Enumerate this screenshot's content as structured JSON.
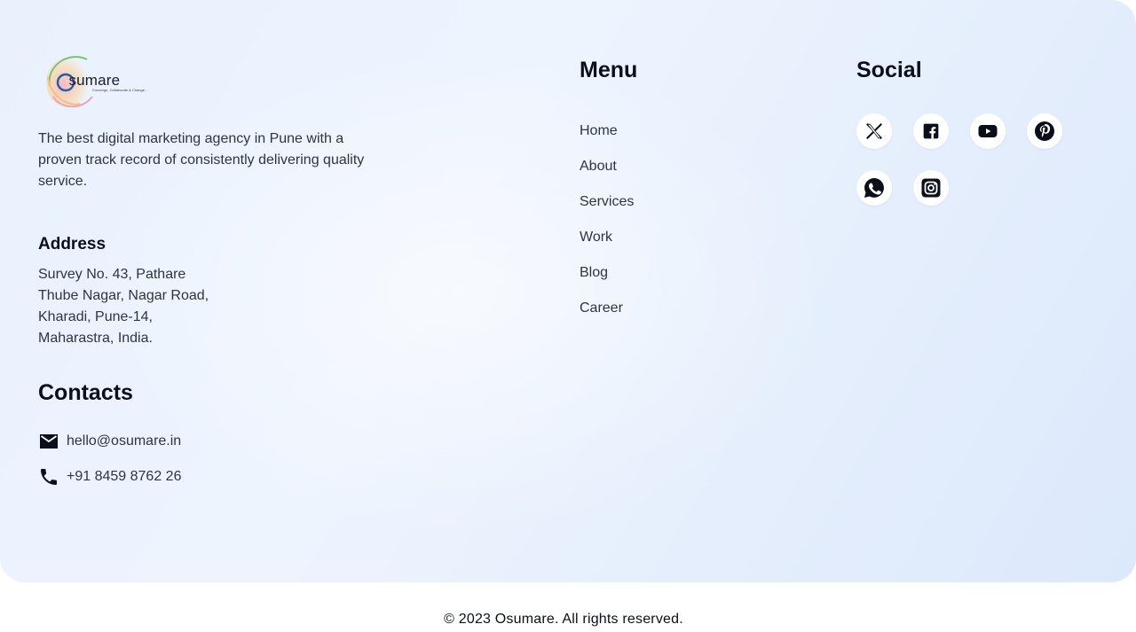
{
  "brand": {
    "logo_text_initial": "O",
    "logo_text_rest": "sumare",
    "logo_tagline": "Converge, Collaborate & Change...",
    "tagline": "The best digital marketing agency in Pune with a proven track record of consistently delivering quality service."
  },
  "address": {
    "heading": "Address",
    "text": "Survey No. 43, Pathare Thube Nagar, Nagar Road, Kharadi, Pune-14, Maharastra, India."
  },
  "contacts": {
    "heading": "Contacts",
    "email": "hello@osumare.in",
    "email_icon": "mail-icon",
    "phone": "+91 8459 8762 26",
    "phone_icon": "phone-icon"
  },
  "menu": {
    "heading": "Menu",
    "items": [
      {
        "label": "Home"
      },
      {
        "label": "About"
      },
      {
        "label": "Services"
      },
      {
        "label": "Work"
      },
      {
        "label": "Blog"
      },
      {
        "label": "Career"
      }
    ]
  },
  "social": {
    "heading": "Social",
    "icons": [
      "x-twitter-icon",
      "facebook-icon",
      "youtube-icon",
      "pinterest-icon",
      "whatsapp-icon",
      "instagram-icon"
    ]
  },
  "footer": {
    "copyright": "© 2023 Osumare. All rights reserved."
  },
  "colors": {
    "background_gradient_start": "#e9f1fd",
    "background_gradient_end": "#dce9fb",
    "heading": "#0b0f1a",
    "body_text": "#2e3440",
    "icon_bg": "#ffffff"
  }
}
